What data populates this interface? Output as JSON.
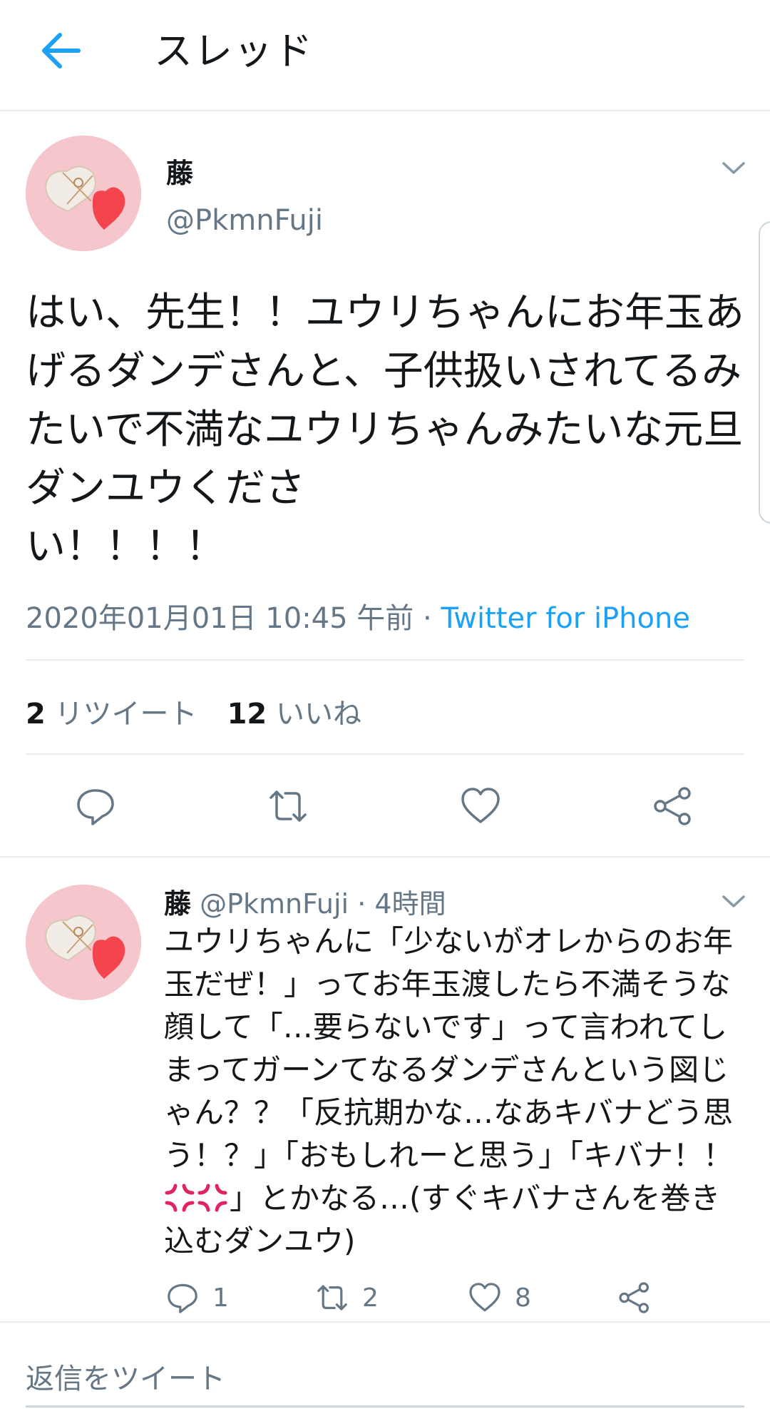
{
  "header": {
    "title": "スレッド"
  },
  "tweet": {
    "name": "藤",
    "handle": "@PkmnFuji",
    "text": "はい、先生！！ユウリちゃんにお年玉あげるダンデさんと、子供扱いされてるみたいで不満なユウリちゃんみたいな元旦ダンユウくださ\nい！！！！",
    "datetime": "2020年01月01日 10:45 午前",
    "separator": " · ",
    "source": "Twitter for iPhone",
    "retweets_count": "2",
    "retweets_label": "リツイート",
    "likes_count": "12",
    "likes_label": "いいね"
  },
  "reply": {
    "name": "藤",
    "handle": "@PkmnFuji",
    "dot": "·",
    "time": "4時間",
    "text_before": "ユウリちゃんに「少ないがオレからのお年玉だぜ！」ってお年玉渡したら不満そうな顔して「…要らないです」って言われてしまってガーンてなるダンデさんという図じゃん？？「反抗期かな…なあキバナどう思う！？」「おもしれーと思う」「キバナ！！",
    "text_after": "」とかなる…(すぐキバナさんを巻き込むダンユウ)",
    "reply_count": "1",
    "retweet_count": "2",
    "like_count": "8"
  },
  "compose": {
    "placeholder": "返信をツイート"
  },
  "colors": {
    "accent": "#1da1f2",
    "secondary_text": "#657786",
    "divider": "#e6ecf0",
    "anger": "#e0245e"
  },
  "icons": [
    "back-arrow-icon",
    "chevron-down-icon",
    "reply-icon",
    "retweet-icon",
    "like-icon",
    "share-icon",
    "anger-symbol-icon"
  ]
}
